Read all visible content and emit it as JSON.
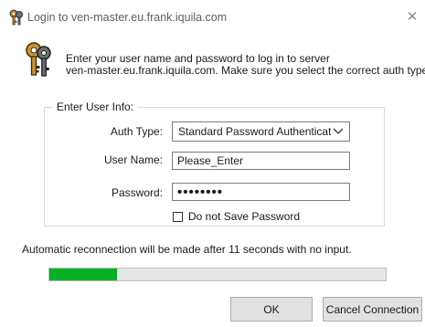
{
  "window": {
    "title": "Login to ven-master.eu.frank.iquila.com",
    "close_glyph": "✕"
  },
  "icons": {
    "title": "keys-icon",
    "header": "keys-icon",
    "close": "close-icon",
    "dropdown": "chevron-down-icon"
  },
  "instructions": {
    "line1": "Enter your user name and password to log in to server",
    "line2": "ven-master.eu.frank.iquila.com. Make sure you select the correct auth type."
  },
  "group": {
    "label": "Enter User Info:"
  },
  "auth_type": {
    "label": "Auth Type:",
    "value": "Standard Password Authentication"
  },
  "user_name": {
    "label": "User Name:",
    "value": "Please_Enter"
  },
  "password": {
    "label": "Password:",
    "value": "••••••••"
  },
  "dont_save": {
    "label": "Do not Save Password",
    "checked": false
  },
  "reconnect": {
    "text": "Automatic reconnection will be made after 11 seconds with no input.",
    "progress_fraction": 0.2,
    "bar_color": "#06b025"
  },
  "buttons": {
    "ok": "OK",
    "cancel": "Cancel Connection"
  }
}
